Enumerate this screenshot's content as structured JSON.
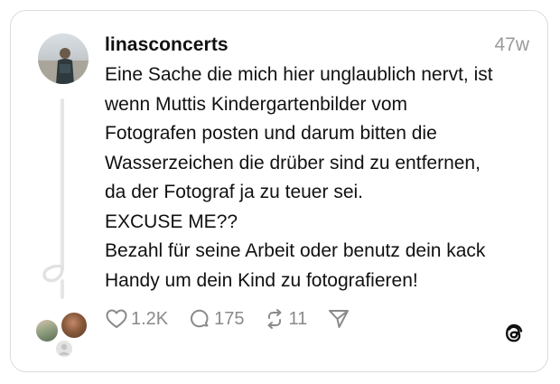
{
  "post": {
    "username": "linasconcerts",
    "timestamp": "47w",
    "lines": [
      "Eine Sache die mich hier unglaublich nervt, ist",
      "wenn Muttis Kindergartenbilder vom",
      "Fotografen posten und darum bitten die",
      "Wasserzeichen die drüber sind zu entfernen,",
      "da der Fotograf ja zu teuer sei.",
      "EXCUSE ME??",
      "Bezahl für seine Arbeit oder benutz dein kack",
      "Handy um dein Kind zu fotografieren!"
    ]
  },
  "actions": {
    "likes": "1.2K",
    "replies": "175",
    "reposts": "11"
  },
  "icons": {
    "like": "heart-icon",
    "reply": "comment-icon",
    "repost": "repost-icon",
    "share": "send-icon",
    "brand": "threads-logo-icon"
  },
  "colors": {
    "text": "#101010",
    "muted": "#8a8a8a",
    "border": "#dcdcdc"
  }
}
